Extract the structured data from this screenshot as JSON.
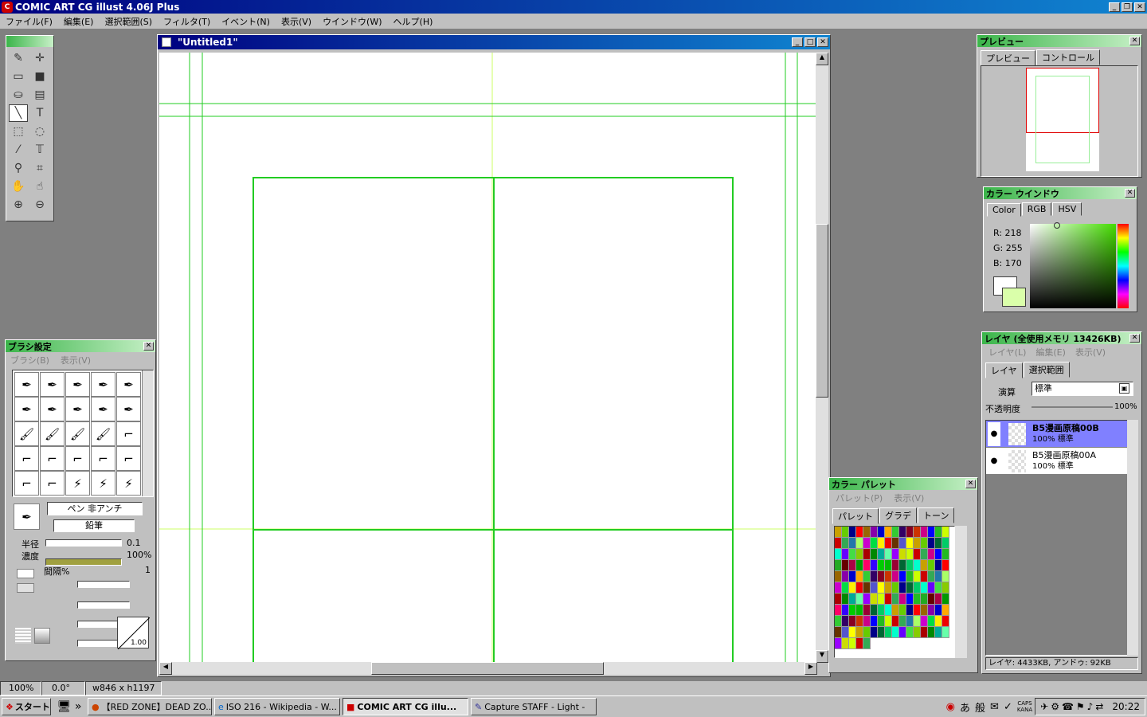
{
  "app_title": "COMIC ART CG illust 4.06J Plus",
  "app_icon_text": "C",
  "menu": [
    "ファイル(F)",
    "編集(E)",
    "選択範囲(S)",
    "フィルタ(T)",
    "イベント(N)",
    "表示(V)",
    "ウインドウ(W)",
    "ヘルプ(H)"
  ],
  "doc": {
    "title": "\"Untitled1\""
  },
  "preview": {
    "title": "プレビュー",
    "tabs": [
      "プレビュー",
      "コントロール"
    ]
  },
  "color_window": {
    "title": "カラー ウインドウ",
    "tabs": [
      "Color",
      "RGB",
      "HSV"
    ],
    "r": "R: 218",
    "g": "G: 255",
    "b": "B: 170",
    "fg_color": "#daffaa",
    "bg_color": "#ffffff"
  },
  "layer": {
    "title": "レイヤ (全使用メモリ 13426KB)",
    "menu": [
      "レイヤ(L)",
      "編集(E)",
      "表示(V)"
    ],
    "tabs": [
      "レイヤ",
      "選択範囲"
    ],
    "op_label": "演算",
    "op_value": "標準",
    "opacity_label": "不透明度",
    "opacity_value": "100%",
    "rows": [
      {
        "name": "B5漫画原稿00B",
        "detail": "100% 標準"
      },
      {
        "name": "B5漫画原稿00A",
        "detail": "100% 標準"
      }
    ],
    "status": "レイヤ: 4433KB, アンドゥ: 92KB"
  },
  "palette": {
    "title": "カラー パレット",
    "menu": [
      "パレット(P)",
      "表示(V)"
    ],
    "tabs": [
      "パレット",
      "グラデ",
      "トーン"
    ]
  },
  "brush": {
    "title": "ブラシ設定",
    "menu": [
      "ブラシ(B)",
      "表示(V)"
    ],
    "name1": "ペン 非アンチ",
    "name2": "鉛筆",
    "radius_label": "半径",
    "radius_value": "0.1",
    "density_label": "濃度",
    "density_value": "100%",
    "interval_label": "間隔%",
    "interval_value": "1",
    "curve_value": "1.00"
  },
  "status": {
    "zoom": "100%",
    "angle": "0.0°",
    "size": "w846 x h1197"
  },
  "taskbar": {
    "start": "スタート",
    "items": [
      "【RED ZONE】DEAD ZO...",
      "ISO 216 - Wikipedia - W...",
      "COMIC ART CG illu...",
      "Capture STAFF - Light -"
    ],
    "clock": "20:22",
    "ime1": "あ",
    "ime2": "般",
    "caps": "CAPS",
    "kana": "KANA"
  },
  "colors": {
    "guide": "#22cc22",
    "guide_light": "#ccff66",
    "accent": "#000080"
  }
}
